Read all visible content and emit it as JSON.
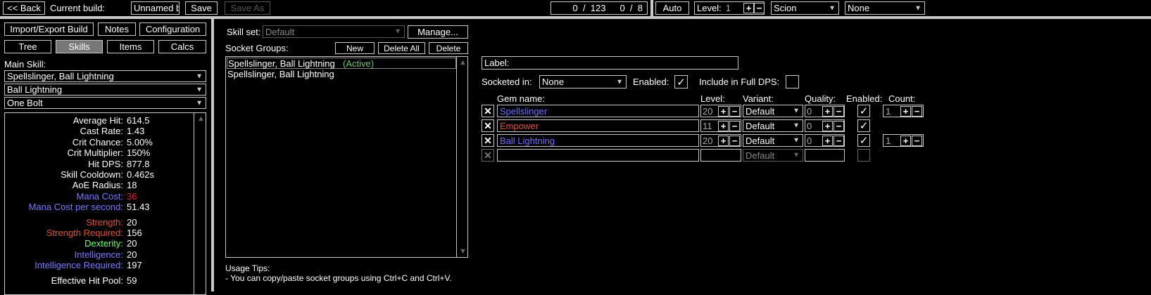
{
  "colors": {
    "bg": "#000000",
    "border": "#c8c8c8",
    "divider": "#c8c8c8",
    "mana": "#7a7aff",
    "strength": "#e05030",
    "dexterity": "#70ff70",
    "intelligence": "#7a7aff",
    "mana_cost_value": "#e02020",
    "active": "#70c070",
    "gem_blue": "#7070ff",
    "gem_red": "#e05030"
  },
  "topbar": {
    "back": "<< Back",
    "current_build_label": "Current build:",
    "build_name": "Unnamed build",
    "save": "Save",
    "save_as": "Save As",
    "points": "0  /  123",
    "ascendancy_points": "0  /  8",
    "auto": "Auto",
    "level_label": "Level:",
    "level_value": "1",
    "class": "Scion",
    "ascendancy": "None"
  },
  "left": {
    "import_export": "Import/Export Build",
    "notes": "Notes",
    "configuration": "Configuration",
    "tabs": {
      "tree": "Tree",
      "skills": "Skills",
      "items": "Items",
      "calcs": "Calcs"
    },
    "main_skill_label": "Main Skill:",
    "main_skill": "Spellslinger, Ball Lightning",
    "active_skill": "Ball Lightning",
    "skill_part": "One Bolt",
    "stats": [
      {
        "label": "Average Hit:",
        "value": "614.5"
      },
      {
        "label": "Cast Rate:",
        "value": "1.43"
      },
      {
        "label": "Crit Chance:",
        "value": "5.00%"
      },
      {
        "label": "Crit Multiplier:",
        "value": "150%"
      },
      {
        "label": "Hit DPS:",
        "value": "877.8"
      },
      {
        "label": "Skill Cooldown:",
        "value": "0.462s"
      },
      {
        "label": "AoE Radius:",
        "value": "18"
      },
      {
        "label": "Mana Cost:",
        "value": "36"
      },
      {
        "label": "Mana Cost per second:",
        "value": "51.43"
      },
      {
        "label": "Strength:",
        "value": "20"
      },
      {
        "label": "Strength Required:",
        "value": "156"
      },
      {
        "label": "Dexterity:",
        "value": "20"
      },
      {
        "label": "Intelligence:",
        "value": "20"
      },
      {
        "label": "Intelligence Required:",
        "value": "197"
      },
      {
        "label": "Effective Hit Pool:",
        "value": "59"
      }
    ]
  },
  "middle": {
    "skill_set_label": "Skill set:",
    "skill_set": "Default",
    "manage": "Manage...",
    "socket_groups_label": "Socket Groups:",
    "new": "New",
    "delete_all": "Delete All",
    "delete": "Delete",
    "groups": [
      {
        "name": "Spellslinger, Ball Lightning",
        "status": "(Active)"
      },
      {
        "name": "Spellslinger, Ball Lightning",
        "status": ""
      }
    ],
    "usage_tips_title": "Usage Tips:",
    "usage_tip_1": "- You can copy/paste socket groups using Ctrl+C and Ctrl+V."
  },
  "right": {
    "label_field": "Label:",
    "socketed_in_label": "Socketed in:",
    "socketed_in": "None",
    "enabled_label": "Enabled:",
    "full_dps_label": "Include in Full DPS:",
    "headers": {
      "gem_name": "Gem name:",
      "level": "Level:",
      "variant": "Variant:",
      "quality": "Quality:",
      "enabled": "Enabled:",
      "count": "Count:"
    },
    "gems": [
      {
        "name": "Spellslinger",
        "level": "20",
        "variant": "Default",
        "quality": "0",
        "count": "1"
      },
      {
        "name": "Empower",
        "level": "11",
        "variant": "Default",
        "quality": "0",
        "count": ""
      },
      {
        "name": "Ball Lightning",
        "level": "20",
        "variant": "Default",
        "quality": "0",
        "count": "1"
      },
      {
        "name": "",
        "level": "",
        "variant": "Default",
        "quality": "",
        "count": ""
      }
    ]
  }
}
